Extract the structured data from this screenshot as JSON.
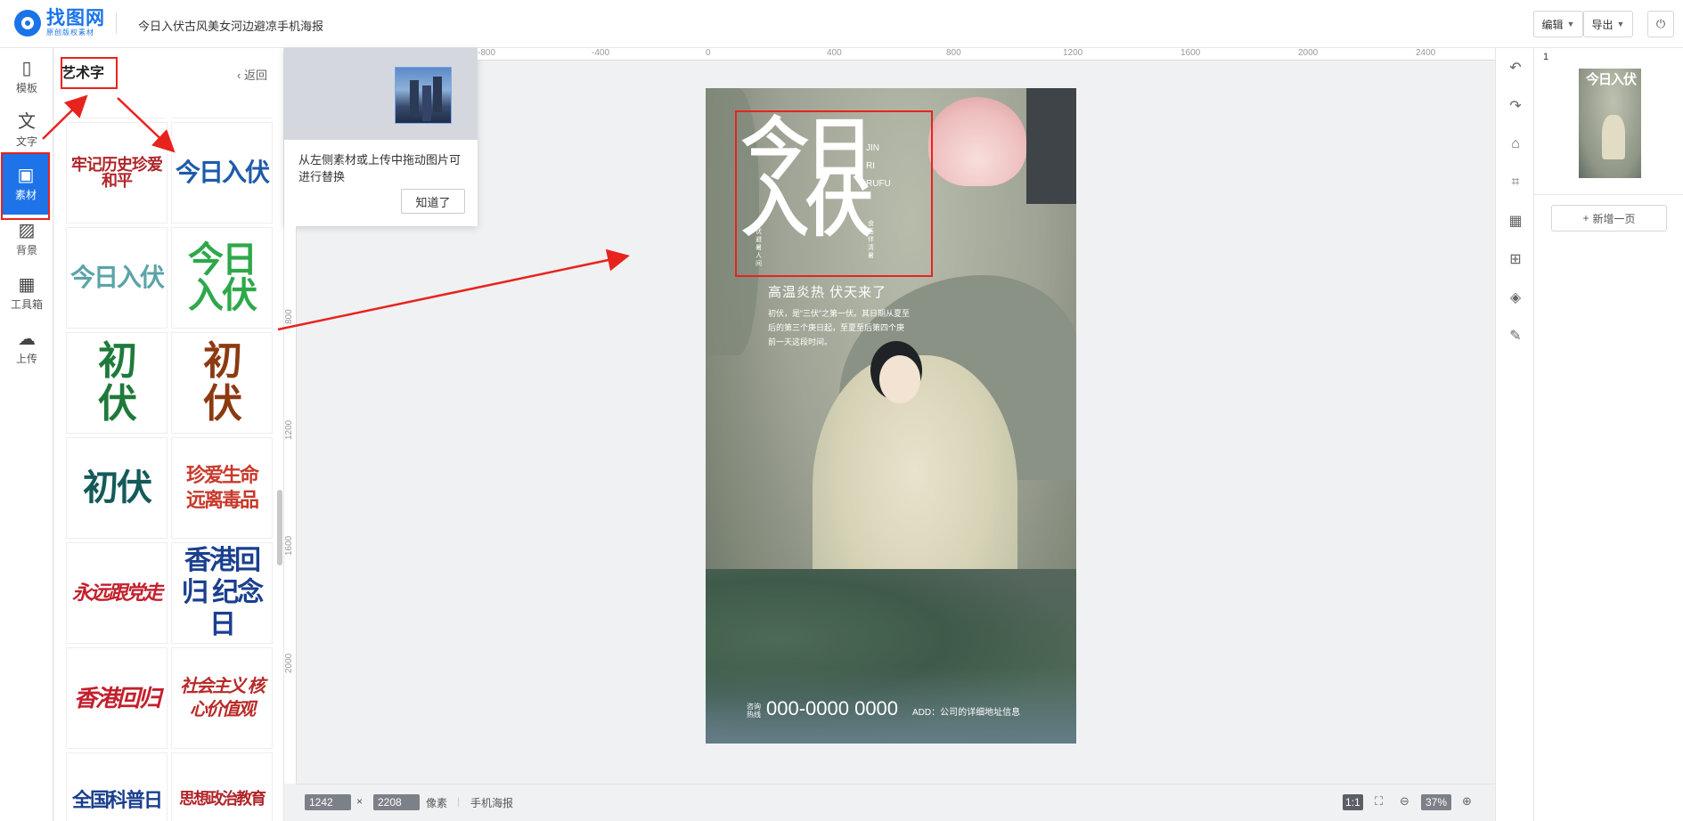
{
  "header": {
    "logo_name": "找图网",
    "logo_sub": "原创版权素材",
    "doc_title": "今日入伏古风美女河边避凉手机海报",
    "edit_label": "编辑",
    "export_label": "导出"
  },
  "rail": [
    {
      "label": "模板",
      "icon": "template-icon",
      "glyph": "▯"
    },
    {
      "label": "文字",
      "icon": "text-icon",
      "glyph": "文"
    },
    {
      "label": "素材",
      "icon": "image-icon",
      "glyph": "▣"
    },
    {
      "label": "背景",
      "icon": "background-icon",
      "glyph": "▨"
    },
    {
      "label": "工具箱",
      "icon": "toolbox-icon",
      "glyph": "▦"
    },
    {
      "label": "上传",
      "icon": "upload-icon",
      "glyph": "☁"
    }
  ],
  "panel": {
    "title": "艺术字",
    "back": "返回",
    "tiles": [
      {
        "text": "牢记历史珍爱和平",
        "color": "#b0252a"
      },
      {
        "text": "今日入伏",
        "color": "#1f5aa8"
      },
      {
        "text": "今日入伏",
        "color": "#5aa4a8"
      },
      {
        "text": "今日入伏",
        "color": "#2ea84a"
      },
      {
        "text": "初伏",
        "color": "#1f7a3a"
      },
      {
        "text": "初伏",
        "color": "#8c3a12"
      },
      {
        "text": "初伏",
        "color": "#155a5a"
      },
      {
        "text": "珍爱生命 远离毒品",
        "color": "#c8392b"
      },
      {
        "text": "永远跟党走",
        "color": "#c41f2c"
      },
      {
        "text": "香港回归 纪念日",
        "color": "#1a3f8f"
      },
      {
        "text": "香港回归",
        "color": "#c41f2c"
      },
      {
        "text": "社会主义 核心价值观",
        "color": "#b82a28"
      },
      {
        "text": "全国科普日",
        "color": "#1a3f8f"
      },
      {
        "text": "思想政治教育",
        "color": "#b0252a"
      }
    ]
  },
  "tooltip": {
    "text": "从左侧素材或上传中拖动图片可进行替换",
    "button": "知道了"
  },
  "ruler": {
    "top_ticks": [
      "-800",
      "-400",
      "0",
      "400",
      "800",
      "1200",
      "1600",
      "2000",
      "2400"
    ],
    "left_ticks": [
      "800",
      "1200",
      "1600",
      "2000"
    ]
  },
  "poster": {
    "title": "今日入伏",
    "en_lines": [
      "JIN",
      "RI",
      "RUFU"
    ],
    "side_left": "三伏避暑人间",
    "side_right": "食荟伴清暑",
    "headline": "高温炎热 伏天来了",
    "body": "初伏，是“三伏”之第一伏。其日期从夏至后的第三个庚日起，至夏至后第四个庚前一天这段时间。",
    "footer_label": "咨询热线",
    "phone": "000-0000 0000",
    "address": "ADD：公司的详细地址信息"
  },
  "pages": {
    "page_number": "1",
    "thumb_title": "今日入伏",
    "add_page": "新增一页"
  },
  "status": {
    "width": "1242",
    "times": "×",
    "height": "2208",
    "unit": "像素",
    "type": "手机海报",
    "ratio": "1:1",
    "zoom": "37%"
  },
  "colors": {
    "accent": "#1e73e8",
    "annotation": "#e8231e"
  }
}
